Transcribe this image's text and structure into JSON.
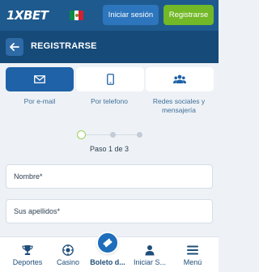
{
  "header": {
    "logo_text": "1XBET",
    "flag_icon": "mexico-flag-icon",
    "login_label": "Iniciar sesión",
    "register_label": "Registrarse",
    "bg_color": "#1e5a8e",
    "register_color": "#72b827"
  },
  "titlebar": {
    "back_icon": "arrow-left-icon",
    "title": "REGISTRARSE"
  },
  "methods": [
    {
      "icon": "envelope-icon",
      "label": "Por e-mail",
      "active": true
    },
    {
      "icon": "phone-icon",
      "label": "Por telefono",
      "active": false
    },
    {
      "icon": "people-icon",
      "label": "Redes sociales y mensajería",
      "active": false
    }
  ],
  "stepper": {
    "text": "Paso 1 de 3",
    "current": 1,
    "total": 3
  },
  "form": {
    "first_name_placeholder": "Nombre*",
    "last_name_placeholder": "Sus apellidos*"
  },
  "bottom_nav": [
    {
      "icon": "trophy-icon",
      "label": "Deportes"
    },
    {
      "icon": "casino-chip-icon",
      "label": "Casino"
    },
    {
      "icon": "ticket-icon",
      "label": "Boleto d..."
    },
    {
      "icon": "user-icon",
      "label": "Iniciar S..."
    },
    {
      "icon": "menu-icon",
      "label": "Menú"
    }
  ]
}
